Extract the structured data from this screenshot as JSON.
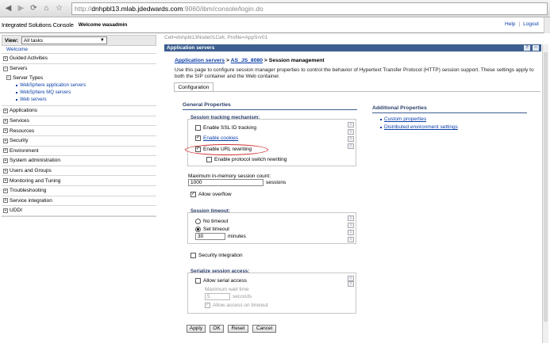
{
  "browser": {
    "back_icon": "back-arrow-icon",
    "forward_icon": "forward-arrow-icon",
    "refresh_icon": "refresh-icon",
    "home_icon": "home-icon",
    "bookmark_icon": "star-icon",
    "url_prefix": "http://",
    "url_host": "dnhpbl13.mlab.jdedwards.com",
    "url_path": ":9060/ibm/console/login.do"
  },
  "header": {
    "title": "Integrated Solutions Console",
    "welcome": "Welcome wasadmin",
    "help": "Help",
    "separator": "|",
    "logout": "Logout"
  },
  "nav": {
    "view_label": "View:",
    "view_value": "All tasks",
    "welcome": "Welcome",
    "sections_before": [
      {
        "label": "Guided Activities",
        "state": "+"
      }
    ],
    "servers": {
      "label": "Servers",
      "state": "−",
      "sub_label": "Server Types",
      "sub_state": "−",
      "links": [
        "WebSphere application servers",
        "WebSphere MQ servers",
        "Web servers"
      ]
    },
    "sections_after": [
      {
        "label": "Applications",
        "state": "+"
      },
      {
        "label": "Services",
        "state": "+"
      },
      {
        "label": "Resources",
        "state": "+"
      },
      {
        "label": "Security",
        "state": "+"
      },
      {
        "label": "Environment",
        "state": "+"
      },
      {
        "label": "System administration",
        "state": "+"
      },
      {
        "label": "Users and Groups",
        "state": "+"
      },
      {
        "label": "Monitoring and Tuning",
        "state": "+"
      },
      {
        "label": "Troubleshooting",
        "state": "+"
      },
      {
        "label": "Service integration",
        "state": "+"
      },
      {
        "label": "UDDI",
        "state": "+"
      }
    ]
  },
  "main": {
    "cell": "Cell=dnhpbl13Node01Cell, Profile=AppSrv01",
    "panel_title": "Application servers",
    "panel_help": "?",
    "panel_min": "−",
    "breadcrumb_1": "Application servers",
    "breadcrumb_sep": " > ",
    "breadcrumb_2": "AS_JS_8080",
    "breadcrumb_3": "Session management",
    "description": "Use this page to configure session manager properties to control the behavior of Hypertext Transfer Protocol (HTTP) session support. These settings apply to both the SIP container and the Web container.",
    "tab": "Configuration",
    "general_properties": "General Properties",
    "tracking_label": "Session tracking mechanism:",
    "ssl_id": "Enable SSL ID tracking",
    "cookies": "Enable cookies",
    "url_rewriting": "Enable URL rewriting",
    "protocol_switch": "Enable protocol switch rewriting",
    "max_count_label": "Maximum in-memory session count:",
    "max_count_value": "1000",
    "sessions_unit": "sessions",
    "allow_overflow": "Allow overflow",
    "timeout_label": "Session timeout:",
    "no_timeout": "No timeout",
    "set_timeout": "Set timeout",
    "timeout_value": "30",
    "minutes_unit": "minutes",
    "security_integration": "Security integration",
    "serialize_label": "Serialize session access:",
    "allow_serial": "Allow serial access",
    "max_wait_label": "Maximum wait time",
    "max_wait_value": "5",
    "seconds_unit": "seconds",
    "allow_access_timeout": "Allow access on timeout",
    "additional_properties": "Additional Properties",
    "custom_properties": "Custom properties",
    "distributed_settings": "Distributed environment settings",
    "check_mark": "✓",
    "help_glyph": "↕",
    "buttons": {
      "apply": "Apply",
      "ok": "OK",
      "reset": "Reset",
      "cancel": "Cancel"
    }
  },
  "colors": {
    "panel_header": "#3d5f8f",
    "link": "#0b3ea8",
    "highlight_oval": "#d03030"
  }
}
